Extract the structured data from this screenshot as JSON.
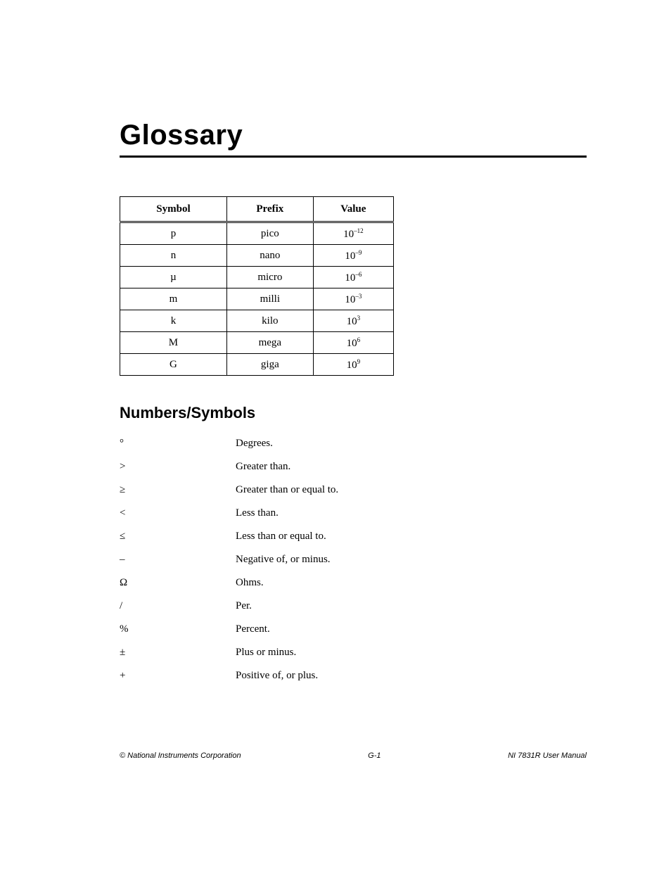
{
  "title": "Glossary",
  "prefix_table": {
    "headers": [
      "Symbol",
      "Prefix",
      "Value"
    ],
    "rows": [
      {
        "symbol": "p",
        "prefix": "pico",
        "base": "10",
        "exp": "–12"
      },
      {
        "symbol": "n",
        "prefix": "nano",
        "base": "10",
        "exp": "–9"
      },
      {
        "symbol": "µ",
        "prefix": "micro",
        "base": "10",
        "exp": "–6"
      },
      {
        "symbol": "m",
        "prefix": "milli",
        "base": "10",
        "exp": "–3"
      },
      {
        "symbol": "k",
        "prefix": "kilo",
        "base": "10",
        "exp": "3"
      },
      {
        "symbol": "M",
        "prefix": "mega",
        "base": "10",
        "exp": "6"
      },
      {
        "symbol": "G",
        "prefix": "giga",
        "base": "10",
        "exp": "9"
      }
    ]
  },
  "section_heading": "Numbers/Symbols",
  "definitions": [
    {
      "symbol": "°",
      "text": "Degrees."
    },
    {
      "symbol": ">",
      "text": "Greater than."
    },
    {
      "symbol": "≥",
      "text": "Greater than or equal to."
    },
    {
      "symbol": "<",
      "text": "Less than."
    },
    {
      "symbol": "≤",
      "text": "Less than or equal to."
    },
    {
      "symbol": "–",
      "text": "Negative of, or minus."
    },
    {
      "symbol": "Ω",
      "text": "Ohms."
    },
    {
      "symbol": "/",
      "text": "Per."
    },
    {
      "symbol": "%",
      "text": "Percent."
    },
    {
      "symbol": "±",
      "text": "Plus or minus."
    },
    {
      "symbol": "+",
      "text": "Positive of, or plus."
    }
  ],
  "footer": {
    "left": "© National Instruments Corporation",
    "center": "G-1",
    "right": "NI 7831R User Manual"
  }
}
